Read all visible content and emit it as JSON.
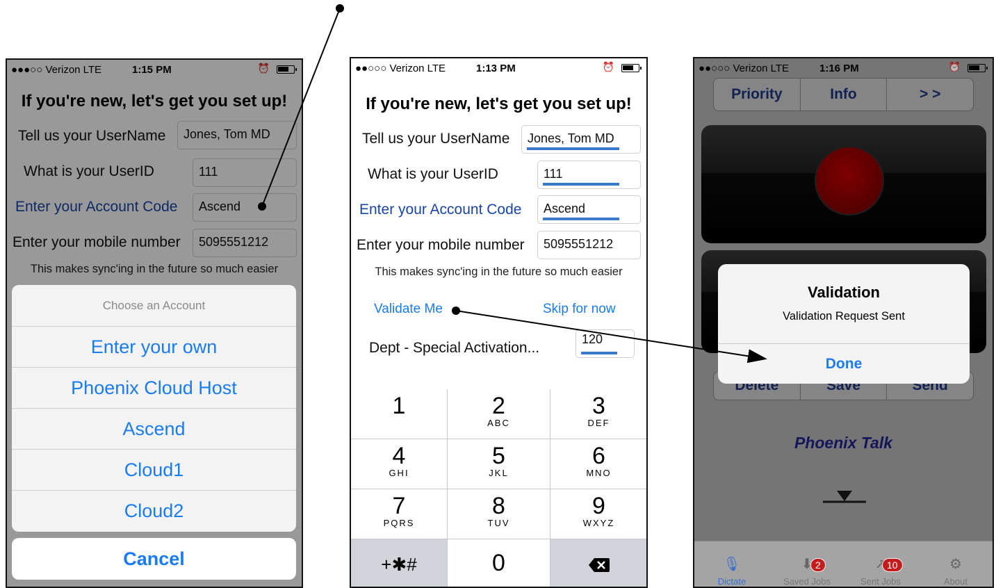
{
  "status": {
    "phone1": {
      "carrier": "●●●○○ Verizon  LTE",
      "time": "1:15 PM",
      "alarm": "⏰"
    },
    "phone2": {
      "carrier": "●●○○○ Verizon  LTE",
      "time": "1:13 PM",
      "alarm": "⏰"
    },
    "phone3": {
      "carrier": "●●○○○ Verizon  LTE",
      "time": "1:16 PM",
      "alarm": "⏰"
    }
  },
  "setup": {
    "title": "If you're new, let's get you set up!",
    "username_label": "Tell us your UserName",
    "username_value": "Jones, Tom MD",
    "userid_label": "What is your UserID",
    "userid_value": "111",
    "account_label": "Enter your Account Code",
    "account_value": "Ascend",
    "mobile_label": "Enter your mobile number",
    "mobile_value": "5095551212",
    "note": "This makes sync'ing in the future so much easier",
    "validate_label": "Validate Me",
    "skip_label": "Skip for now",
    "dept_label": "Dept - Special Activation...",
    "dept_value": "120"
  },
  "account_sheet": {
    "header": "Choose an Account",
    "options": [
      "Enter your own",
      "Phoenix Cloud Host",
      "Ascend",
      "Cloud1",
      "Cloud2"
    ],
    "cancel": "Cancel"
  },
  "keypad": {
    "keys": [
      {
        "num": "1",
        "letters": ""
      },
      {
        "num": "2",
        "letters": "ABC"
      },
      {
        "num": "3",
        "letters": "DEF"
      },
      {
        "num": "4",
        "letters": "GHI"
      },
      {
        "num": "5",
        "letters": "JKL"
      },
      {
        "num": "6",
        "letters": "MNO"
      },
      {
        "num": "7",
        "letters": "PQRS"
      },
      {
        "num": "8",
        "letters": "TUV"
      },
      {
        "num": "9",
        "letters": "WXYZ"
      }
    ],
    "symbols": "+✱#",
    "zero": "0",
    "delete_icon": "backspace-icon"
  },
  "dictate": {
    "segments": [
      "Priority",
      "Info",
      "> >"
    ],
    "bottom_buttons": [
      "Delete",
      "Save",
      "Send"
    ],
    "brand": "Phoenix Talk",
    "alert": {
      "title": "Validation",
      "message": "Validation Request Sent",
      "button": "Done"
    },
    "tabs": [
      {
        "label": "Dictate",
        "icon": "microphone-icon",
        "badge": ""
      },
      {
        "label": "Saved Jobs",
        "icon": "download-icon",
        "badge": "2"
      },
      {
        "label": "Sent Jobs",
        "icon": "sent-icon",
        "badge": "10"
      },
      {
        "label": "About",
        "icon": "gear-icon",
        "badge": ""
      }
    ]
  },
  "colors": {
    "ios_blue": "#1a7cf0",
    "label_blue": "#1a45a8",
    "underline": "#3a7ac9",
    "record_red": "#a80000"
  }
}
